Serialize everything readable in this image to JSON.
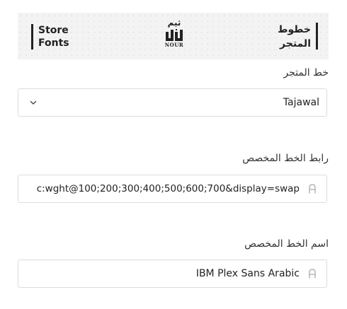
{
  "banner": {
    "left_line1": "Store",
    "left_line2": "Fonts",
    "right_line1": "خطوط",
    "right_line2": "المتجر",
    "logo_top": "ثيم",
    "logo_sub": "NOUR"
  },
  "store_font": {
    "label": "خط المتجر",
    "value": "Tajawal"
  },
  "custom_font_url": {
    "label": "رابط الخط المخصص",
    "value": "c:wght@100;200;300;400;500;600;700&display=swap"
  },
  "custom_font_name": {
    "label": "اسم الخط المخصص",
    "value": "IBM Plex Sans Arabic"
  },
  "icons": {
    "select_chevron": "chevron-down-icon",
    "text_icon": "text-a-icon"
  }
}
